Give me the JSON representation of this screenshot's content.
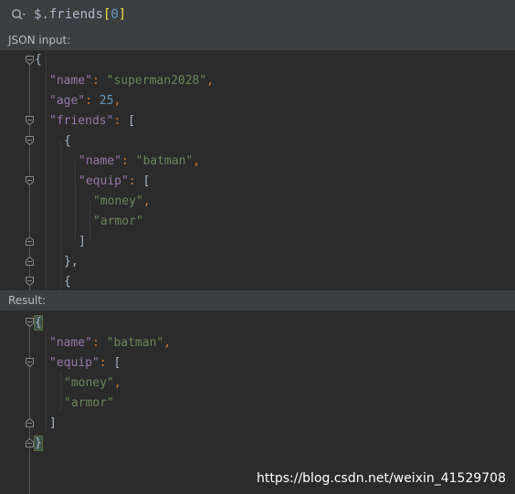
{
  "query": {
    "dollar": "$",
    "path": ".friends",
    "open": "[",
    "index": "0",
    "close": "]"
  },
  "json_input": {
    "label": "JSON input:",
    "lines": {
      "l1": "{",
      "l2_key": "\"name\"",
      "l2_val": "\"superman2028\"",
      "l3_key": "\"age\"",
      "l3_val": "25",
      "l4_key": "\"friends\"",
      "l4_open": "[",
      "l5": "{",
      "l6_key": "\"name\"",
      "l6_val": "\"batman\"",
      "l7_key": "\"equip\"",
      "l7_open": "[",
      "l8": "\"money\"",
      "l9": "\"armor\"",
      "l10": "]",
      "l11": "},",
      "l12": "{"
    }
  },
  "result": {
    "label": "Result:",
    "lines": {
      "l1": "{",
      "l2_key": "\"name\"",
      "l2_val": "\"batman\"",
      "l3_key": "\"equip\"",
      "l3_open": "[",
      "l4": "\"money\"",
      "l5": "\"armor\"",
      "l6": "]",
      "l7": "}"
    }
  },
  "watermark": "https://blog.csdn.net/weixin_41529708"
}
